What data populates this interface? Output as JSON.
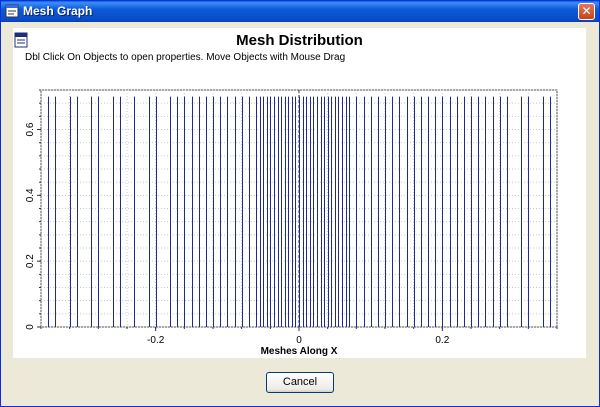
{
  "window": {
    "title": "Mesh Graph",
    "close_label": "✕"
  },
  "header": {
    "hint": "Dbl Click On Objects to open properties.  Move Objects with Mouse Drag"
  },
  "buttons": {
    "cancel_label": "Cancel"
  },
  "colors": {
    "mesh_line": "#1f2a8c",
    "window_bg": "#ece9d8",
    "title_bar": "#0a5fe8"
  },
  "chart_data": {
    "type": "bar",
    "title": "Mesh Distribution",
    "xlabel": "Meshes Along X",
    "ylabel": "",
    "xlim": [
      -0.36,
      0.36
    ],
    "ylim": [
      0,
      0.72
    ],
    "grid": true,
    "x_ticks": [
      -0.2,
      0,
      0.2
    ],
    "x_tick_labels": [
      "-0.2",
      "0",
      "0.2"
    ],
    "y_ticks": [
      0,
      0.2,
      0.4,
      0.6
    ],
    "y_tick_labels": [
      "0",
      "0.2",
      "0.4",
      "0.6"
    ],
    "series": [
      {
        "values": [
          0.7,
          0.7,
          0.7,
          0.7,
          0.7,
          0.7,
          0.7,
          0.7,
          0.7,
          0.7,
          0.7,
          0.7,
          0.7,
          0.7,
          0.7,
          0.7,
          0.7,
          0.7,
          0.7,
          0.7,
          0.7,
          0.7,
          0.7,
          0.7,
          0.7,
          0.7,
          0.7,
          0.7,
          0.7,
          0.7,
          0.7,
          0.7,
          0.7,
          0.7,
          0.7,
          0.7,
          0.7,
          0.7,
          0.7,
          0.7,
          0.7,
          0.7,
          0.7,
          0.7,
          0.7,
          0.7,
          0.7,
          0.7,
          0.7,
          0.7,
          0.7,
          0.7,
          0.7,
          0.7,
          0.7,
          0.7,
          0.7,
          0.7,
          0.7,
          0.7,
          0.7,
          0.7,
          0.7,
          0.7,
          0.7,
          0.7,
          0.7,
          0.7,
          0.7,
          0.7,
          0.7,
          0.7,
          0.7,
          0.7,
          0.7,
          0.7
        ]
      }
    ],
    "x": [
      -0.35,
      -0.34,
      -0.32,
      -0.31,
      -0.29,
      -0.28,
      -0.26,
      -0.25,
      -0.23,
      -0.21,
      -0.2,
      -0.18,
      -0.17,
      -0.16,
      -0.15,
      -0.14,
      -0.13,
      -0.12,
      -0.11,
      -0.1,
      -0.09,
      -0.08,
      -0.07,
      -0.06,
      -0.055,
      -0.05,
      -0.045,
      -0.04,
      -0.035,
      -0.03,
      -0.025,
      -0.02,
      -0.015,
      -0.01,
      -0.005,
      0,
      0.005,
      0.01,
      0.015,
      0.02,
      0.025,
      0.03,
      0.035,
      0.04,
      0.045,
      0.05,
      0.055,
      0.06,
      0.065,
      0.07,
      0.08,
      0.09,
      0.1,
      0.11,
      0.12,
      0.13,
      0.14,
      0.15,
      0.16,
      0.17,
      0.18,
      0.19,
      0.2,
      0.21,
      0.22,
      0.23,
      0.24,
      0.25,
      0.26,
      0.27,
      0.28,
      0.29,
      0.31,
      0.32,
      0.34,
      0.35
    ]
  }
}
